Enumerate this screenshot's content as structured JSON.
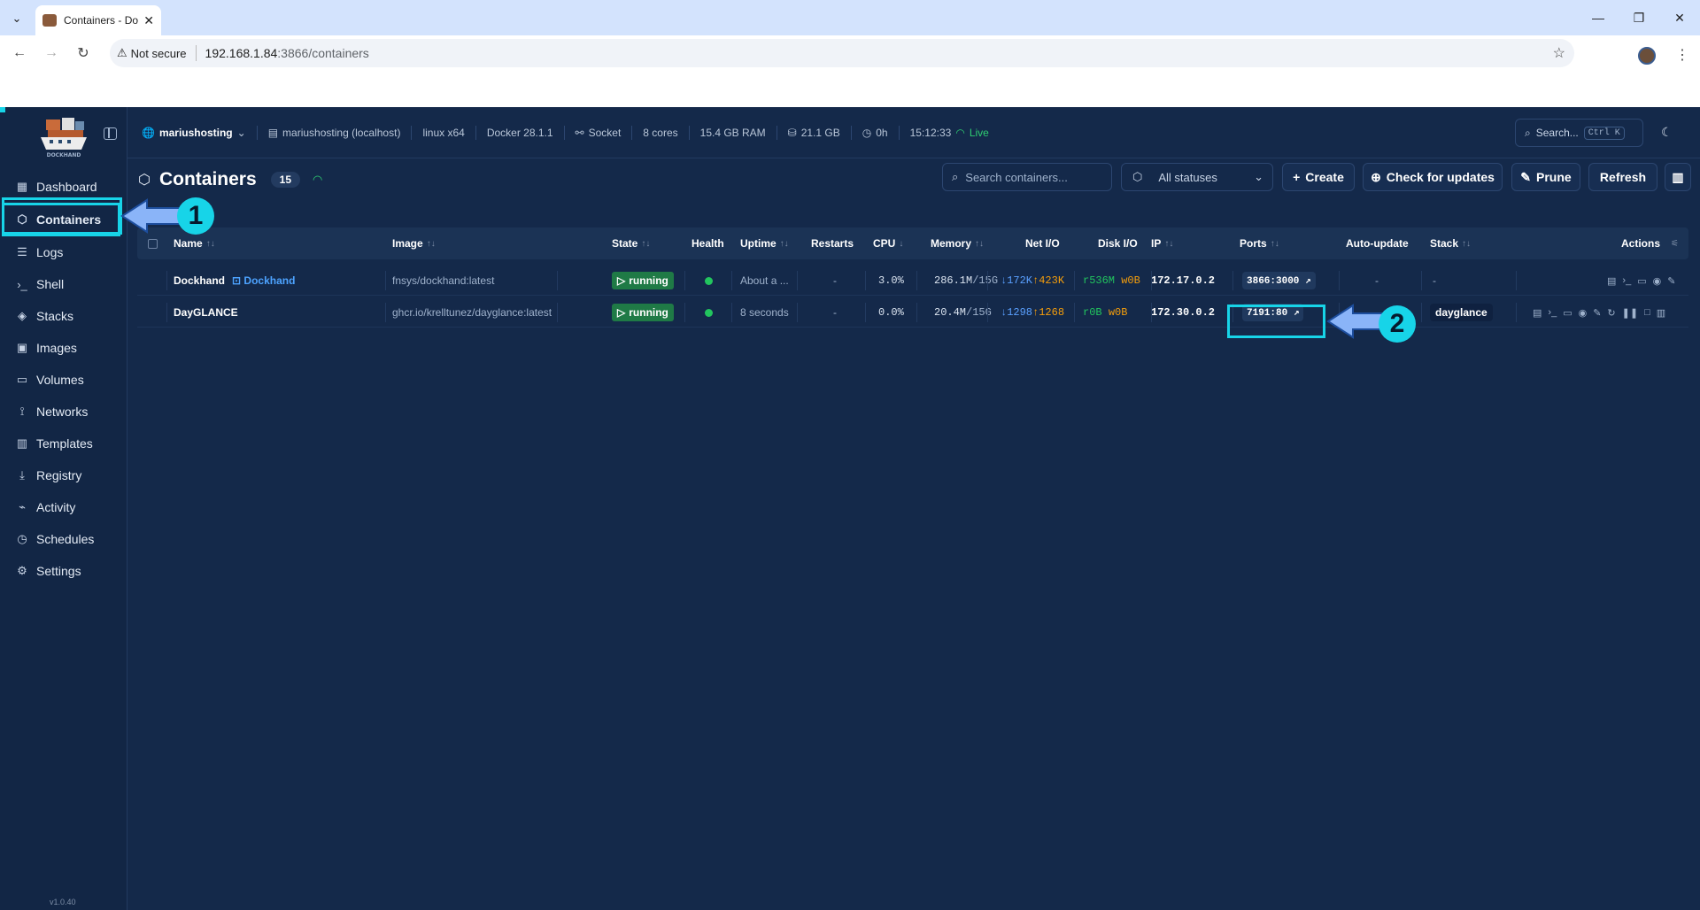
{
  "browser": {
    "tab_title": "Containers - Do",
    "security": "Not secure",
    "url_host": "192.168.1.84",
    "url_path": ":3866/containers"
  },
  "infobar": {
    "env": "mariushosting",
    "host": "mariushosting (localhost)",
    "os": "linux x64",
    "docker": "Docker 28.1.1",
    "conn": "Socket",
    "cores": "8 cores",
    "ram": "15.4 GB RAM",
    "disk": "21.1 GB",
    "uptime": "0h",
    "time": "15:12:33",
    "live": "Live",
    "search": "Search...",
    "search_kbd": "Ctrl K"
  },
  "sidebar": {
    "logo_text": "DOCKHAND",
    "items": [
      {
        "label": "Dashboard",
        "icon": "dashboard-icon",
        "glyph": "▦"
      },
      {
        "label": "Containers",
        "icon": "box-icon",
        "glyph": "⬡"
      },
      {
        "label": "Logs",
        "icon": "logs-icon",
        "glyph": "☰"
      },
      {
        "label": "Shell",
        "icon": "terminal-icon",
        "glyph": "›_"
      },
      {
        "label": "Stacks",
        "icon": "layers-icon",
        "glyph": "◈"
      },
      {
        "label": "Images",
        "icon": "images-icon",
        "glyph": "▣"
      },
      {
        "label": "Volumes",
        "icon": "hard-drive-icon",
        "glyph": "▭"
      },
      {
        "label": "Networks",
        "icon": "network-icon",
        "glyph": "⟟"
      },
      {
        "label": "Templates",
        "icon": "book-icon",
        "glyph": "▥"
      },
      {
        "label": "Registry",
        "icon": "download-icon",
        "glyph": "⤓"
      },
      {
        "label": "Activity",
        "icon": "activity-icon",
        "glyph": "⌁"
      },
      {
        "label": "Schedules",
        "icon": "timer-icon",
        "glyph": "◷"
      },
      {
        "label": "Settings",
        "icon": "gear-icon",
        "glyph": "⚙"
      }
    ],
    "version": "v1.0.40"
  },
  "page": {
    "title": "Containers",
    "count": "15",
    "search_placeholder": "Search containers...",
    "status_filter": "All statuses",
    "create": "Create",
    "check_updates": "Check for updates",
    "prune": "Prune",
    "refresh": "Refresh"
  },
  "table": {
    "headers": {
      "name": "Name",
      "image": "Image",
      "state": "State",
      "health": "Health",
      "uptime": "Uptime",
      "restarts": "Restarts",
      "cpu": "CPU",
      "memory": "Memory",
      "netio": "Net I/O",
      "diskio": "Disk I/O",
      "ip": "IP",
      "ports": "Ports",
      "autoupdate": "Auto-update",
      "stack": "Stack",
      "actions": "Actions"
    },
    "rows": [
      {
        "name": "Dockhand",
        "self_badge": "Dockhand",
        "image": "fnsys/dockhand:latest",
        "state": "running",
        "uptime": "About a ...",
        "restarts": "-",
        "cpu": "3.0%",
        "mem_used": "286.1M",
        "mem_limit": "/15G",
        "net_down": "↓172K",
        "net_up": "↑423K",
        "disk_r": "r536M",
        "disk_w": "w0B",
        "ip": "172.17.0.2",
        "port": "3866:3000",
        "autoupdate": "-",
        "stack": "-"
      },
      {
        "name": "DayGLANCE",
        "self_badge": "",
        "image": "ghcr.io/krelltunez/dayglance:latest",
        "state": "running",
        "uptime": "8 seconds",
        "restarts": "-",
        "cpu": "0.0%",
        "mem_used": "20.4M",
        "mem_limit": "/15G",
        "net_down": "↓1298",
        "net_up": "↑1268",
        "disk_r": "r0B",
        "disk_w": "w0B",
        "ip": "172.30.0.2",
        "port": "7191:80",
        "autoupdate": "",
        "stack": "dayglance"
      }
    ]
  },
  "annotations": {
    "one": "1",
    "two": "2"
  },
  "colors": {
    "accent": "#17d4e8",
    "running": "#1f7a46",
    "healthy": "#22c55e",
    "bg": "#14294a"
  }
}
